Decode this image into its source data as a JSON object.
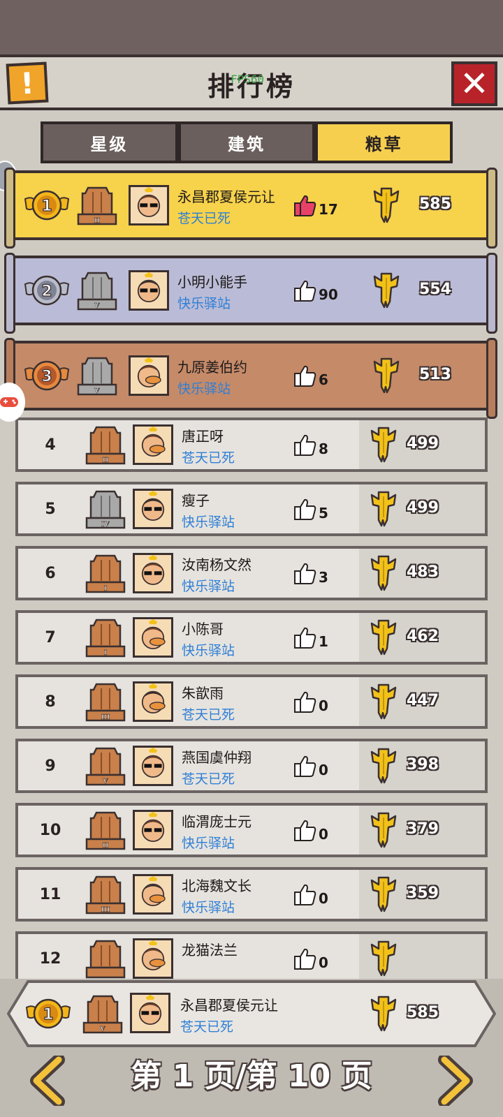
{
  "header": {
    "title": "排行榜",
    "fps_overlay": "FPS60",
    "info_icon": "exclamation-icon",
    "close_icon": "close-icon"
  },
  "tabs": [
    {
      "label": "星级",
      "active": false
    },
    {
      "label": "建筑",
      "active": false
    },
    {
      "label": "粮草",
      "active": true
    }
  ],
  "rows": [
    {
      "rank": "1",
      "name": "永昌郡夏侯元让",
      "server": "苍天已死",
      "likes": "17",
      "score": "585",
      "tier": "II",
      "tier_color": "bronze",
      "liked": true
    },
    {
      "rank": "2",
      "name": "小明小能手",
      "server": "快乐驿站",
      "likes": "90",
      "score": "554",
      "tier": "V",
      "tier_color": "silver",
      "liked": false
    },
    {
      "rank": "3",
      "name": "九原姜伯约",
      "server": "快乐驿站",
      "likes": "6",
      "score": "513",
      "tier": "V",
      "tier_color": "silver",
      "liked": false
    },
    {
      "rank": "4",
      "name": "唐正呀",
      "server": "苍天已死",
      "likes": "8",
      "score": "499",
      "tier": "II",
      "tier_color": "bronze",
      "liked": false
    },
    {
      "rank": "5",
      "name": "瘦子",
      "server": "快乐驿站",
      "likes": "5",
      "score": "499",
      "tier": "IV",
      "tier_color": "silver",
      "liked": false
    },
    {
      "rank": "6",
      "name": "汝南杨文然",
      "server": "快乐驿站",
      "likes": "3",
      "score": "483",
      "tier": "I",
      "tier_color": "bronze",
      "liked": false
    },
    {
      "rank": "7",
      "name": "小陈哥",
      "server": "快乐驿站",
      "likes": "1",
      "score": "462",
      "tier": "I",
      "tier_color": "bronze",
      "liked": false
    },
    {
      "rank": "8",
      "name": "朱歆雨",
      "server": "苍天已死",
      "likes": "0",
      "score": "447",
      "tier": "III",
      "tier_color": "bronze",
      "liked": false
    },
    {
      "rank": "9",
      "name": "燕国虞仲翔",
      "server": "苍天已死",
      "likes": "0",
      "score": "398",
      "tier": "V",
      "tier_color": "bronze",
      "liked": false
    },
    {
      "rank": "10",
      "name": "临渭庞士元",
      "server": "快乐驿站",
      "likes": "0",
      "score": "379",
      "tier": "II",
      "tier_color": "bronze",
      "liked": false
    },
    {
      "rank": "11",
      "name": "北海魏文长",
      "server": "快乐驿站",
      "likes": "0",
      "score": "359",
      "tier": "III",
      "tier_color": "bronze",
      "liked": false
    },
    {
      "rank": "12",
      "name": "龙猫法兰",
      "server": "",
      "likes": "0",
      "score": "",
      "tier": "",
      "tier_color": "bronze",
      "liked": false
    }
  ],
  "my_rank": {
    "rank": "1",
    "name": "永昌郡夏侯元让",
    "server": "苍天已死",
    "score": "585",
    "tier": "V",
    "tier_color": "bronze"
  },
  "pagination": {
    "text": "第 1 页/第 10 页",
    "prev_icon": "chevron-left-icon",
    "next_icon": "chevron-right-icon"
  },
  "colors": {
    "rank1": "#f7d24b",
    "rank2": "#babbd6",
    "rank3": "#c58a68",
    "active_tab": "#f6cf4f",
    "server_text": "#2f7fd6",
    "close_button": "#b8232a",
    "info_button": "#f0a429",
    "grain": "#f2c21a"
  }
}
